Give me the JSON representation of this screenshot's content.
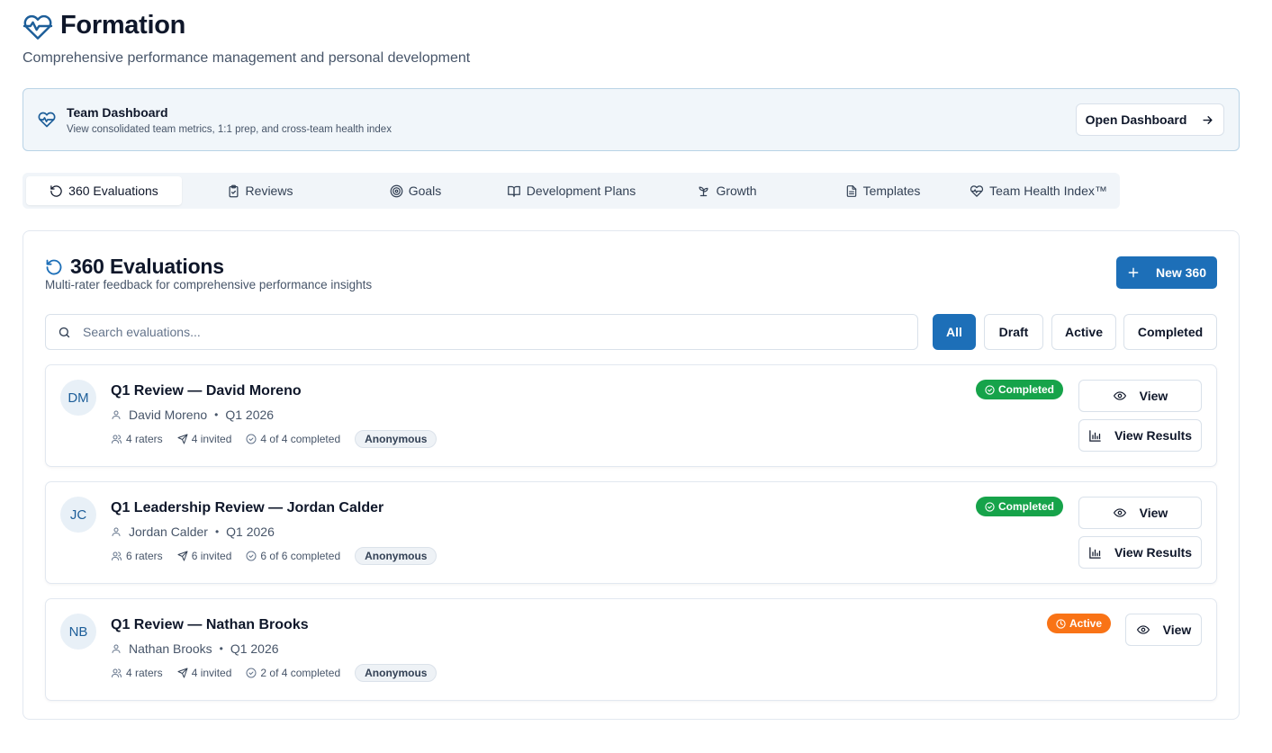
{
  "app": {
    "title": "Formation",
    "subtitle": "Comprehensive performance management and personal development"
  },
  "banner": {
    "title": "Team Dashboard",
    "subtitle": "View consolidated team metrics, 1:1 prep, and cross-team health index",
    "button_label": "Open Dashboard"
  },
  "tabs": [
    {
      "label": "360 Evaluations",
      "icon": "rotate-ccw-icon",
      "active": true
    },
    {
      "label": "Reviews",
      "icon": "clipboard-check-icon",
      "active": false
    },
    {
      "label": "Goals",
      "icon": "target-icon",
      "active": false
    },
    {
      "label": "Development Plans",
      "icon": "book-open-icon",
      "active": false
    },
    {
      "label": "Growth",
      "icon": "sprout-icon",
      "active": false
    },
    {
      "label": "Templates",
      "icon": "file-text-icon",
      "active": false
    },
    {
      "label": "Team Health Index™",
      "icon": "heart-pulse-icon",
      "active": false
    }
  ],
  "section": {
    "title": "360 Evaluations",
    "subtitle": "Multi-rater feedback for comprehensive performance insights",
    "new_button": "New 360"
  },
  "search": {
    "placeholder": "Search evaluations...",
    "value": ""
  },
  "filters": [
    {
      "label": "All",
      "active": true
    },
    {
      "label": "Draft",
      "active": false
    },
    {
      "label": "Active",
      "active": false
    },
    {
      "label": "Completed",
      "active": false
    }
  ],
  "evaluations": [
    {
      "initials": "DM",
      "title": "Q1 Review — David Moreno",
      "person": "David Moreno",
      "period": "Q1 2026",
      "raters": "4 raters",
      "invited": "4 invited",
      "completed": "4 of 4 completed",
      "badge": "Anonymous",
      "status": "Completed",
      "view_label": "View",
      "results_label": "View Results"
    },
    {
      "initials": "JC",
      "title": "Q1 Leadership Review — Jordan Calder",
      "person": "Jordan Calder",
      "period": "Q1 2026",
      "raters": "6 raters",
      "invited": "6 invited",
      "completed": "6 of 6 completed",
      "badge": "Anonymous",
      "status": "Completed",
      "view_label": "View",
      "results_label": "View Results"
    },
    {
      "initials": "NB",
      "title": "Q1 Review — Nathan Brooks",
      "person": "Nathan Brooks",
      "period": "Q1 2026",
      "raters": "4 raters",
      "invited": "4 invited",
      "completed": "2 of 4 completed",
      "badge": "Anonymous",
      "status": "Active",
      "view_label": "View"
    }
  ],
  "colors": {
    "primary": "#1d6fb8",
    "completed": "#16a34a",
    "active": "#f97316",
    "banner_bg": "#f1f6fa"
  }
}
